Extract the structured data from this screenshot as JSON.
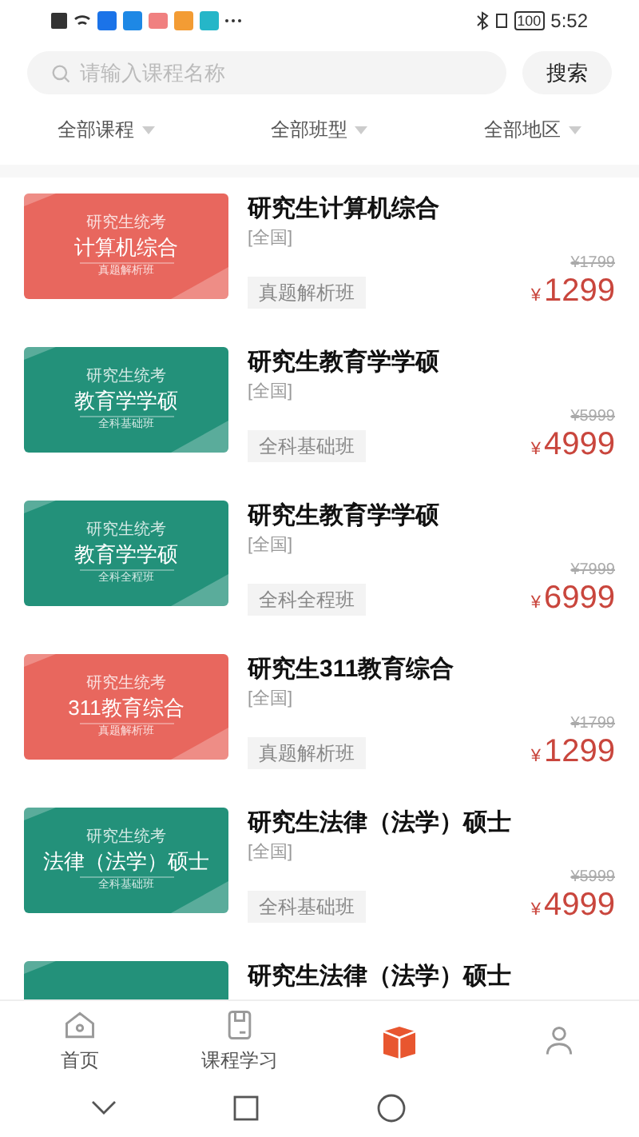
{
  "status_bar": {
    "battery": "100",
    "time": "5:52"
  },
  "search": {
    "placeholder": "请输入课程名称",
    "button": "搜索"
  },
  "filters": [
    {
      "label": "全部课程"
    },
    {
      "label": "全部班型"
    },
    {
      "label": "全部地区"
    }
  ],
  "courses": [
    {
      "color": "#e8675e",
      "cover": {
        "exam": "研究生统考",
        "name": "计算机综合",
        "class_type": "真题解析班"
      },
      "title": "研究生计算机综合",
      "region": "[全国]",
      "tag": "真题解析班",
      "original_price": "¥1799",
      "currency": "¥",
      "price": "1299"
    },
    {
      "color": "#23917a",
      "cover": {
        "exam": "研究生统考",
        "name": "教育学学硕",
        "class_type": "全科基础班"
      },
      "title": "研究生教育学学硕",
      "region": "[全国]",
      "tag": "全科基础班",
      "original_price": "¥5999",
      "currency": "¥",
      "price": "4999"
    },
    {
      "color": "#23917a",
      "cover": {
        "exam": "研究生统考",
        "name": "教育学学硕",
        "class_type": "全科全程班"
      },
      "title": "研究生教育学学硕",
      "region": "[全国]",
      "tag": "全科全程班",
      "original_price": "¥7999",
      "currency": "¥",
      "price": "6999"
    },
    {
      "color": "#e8675e",
      "cover": {
        "exam": "研究生统考",
        "name": "311教育综合",
        "class_type": "真题解析班"
      },
      "title": "研究生311教育综合",
      "region": "[全国]",
      "tag": "真题解析班",
      "original_price": "¥1799",
      "currency": "¥",
      "price": "1299"
    },
    {
      "color": "#23917a",
      "cover": {
        "exam": "研究生统考",
        "name": "法律（法学）硕士",
        "class_type": "全科基础班"
      },
      "title": "研究生法律（法学）硕士",
      "region": "[全国]",
      "tag": "全科基础班",
      "original_price": "¥5999",
      "currency": "¥",
      "price": "4999"
    },
    {
      "color": "#23917a",
      "title": "研究生法律（法学）硕士"
    }
  ],
  "tab_bar": [
    {
      "kind": "home",
      "label": "首页",
      "selected": false
    },
    {
      "kind": "study",
      "label": "课程学习",
      "selected": false
    },
    {
      "kind": "courses",
      "selected": true
    },
    {
      "kind": "profile",
      "selected": false
    }
  ]
}
